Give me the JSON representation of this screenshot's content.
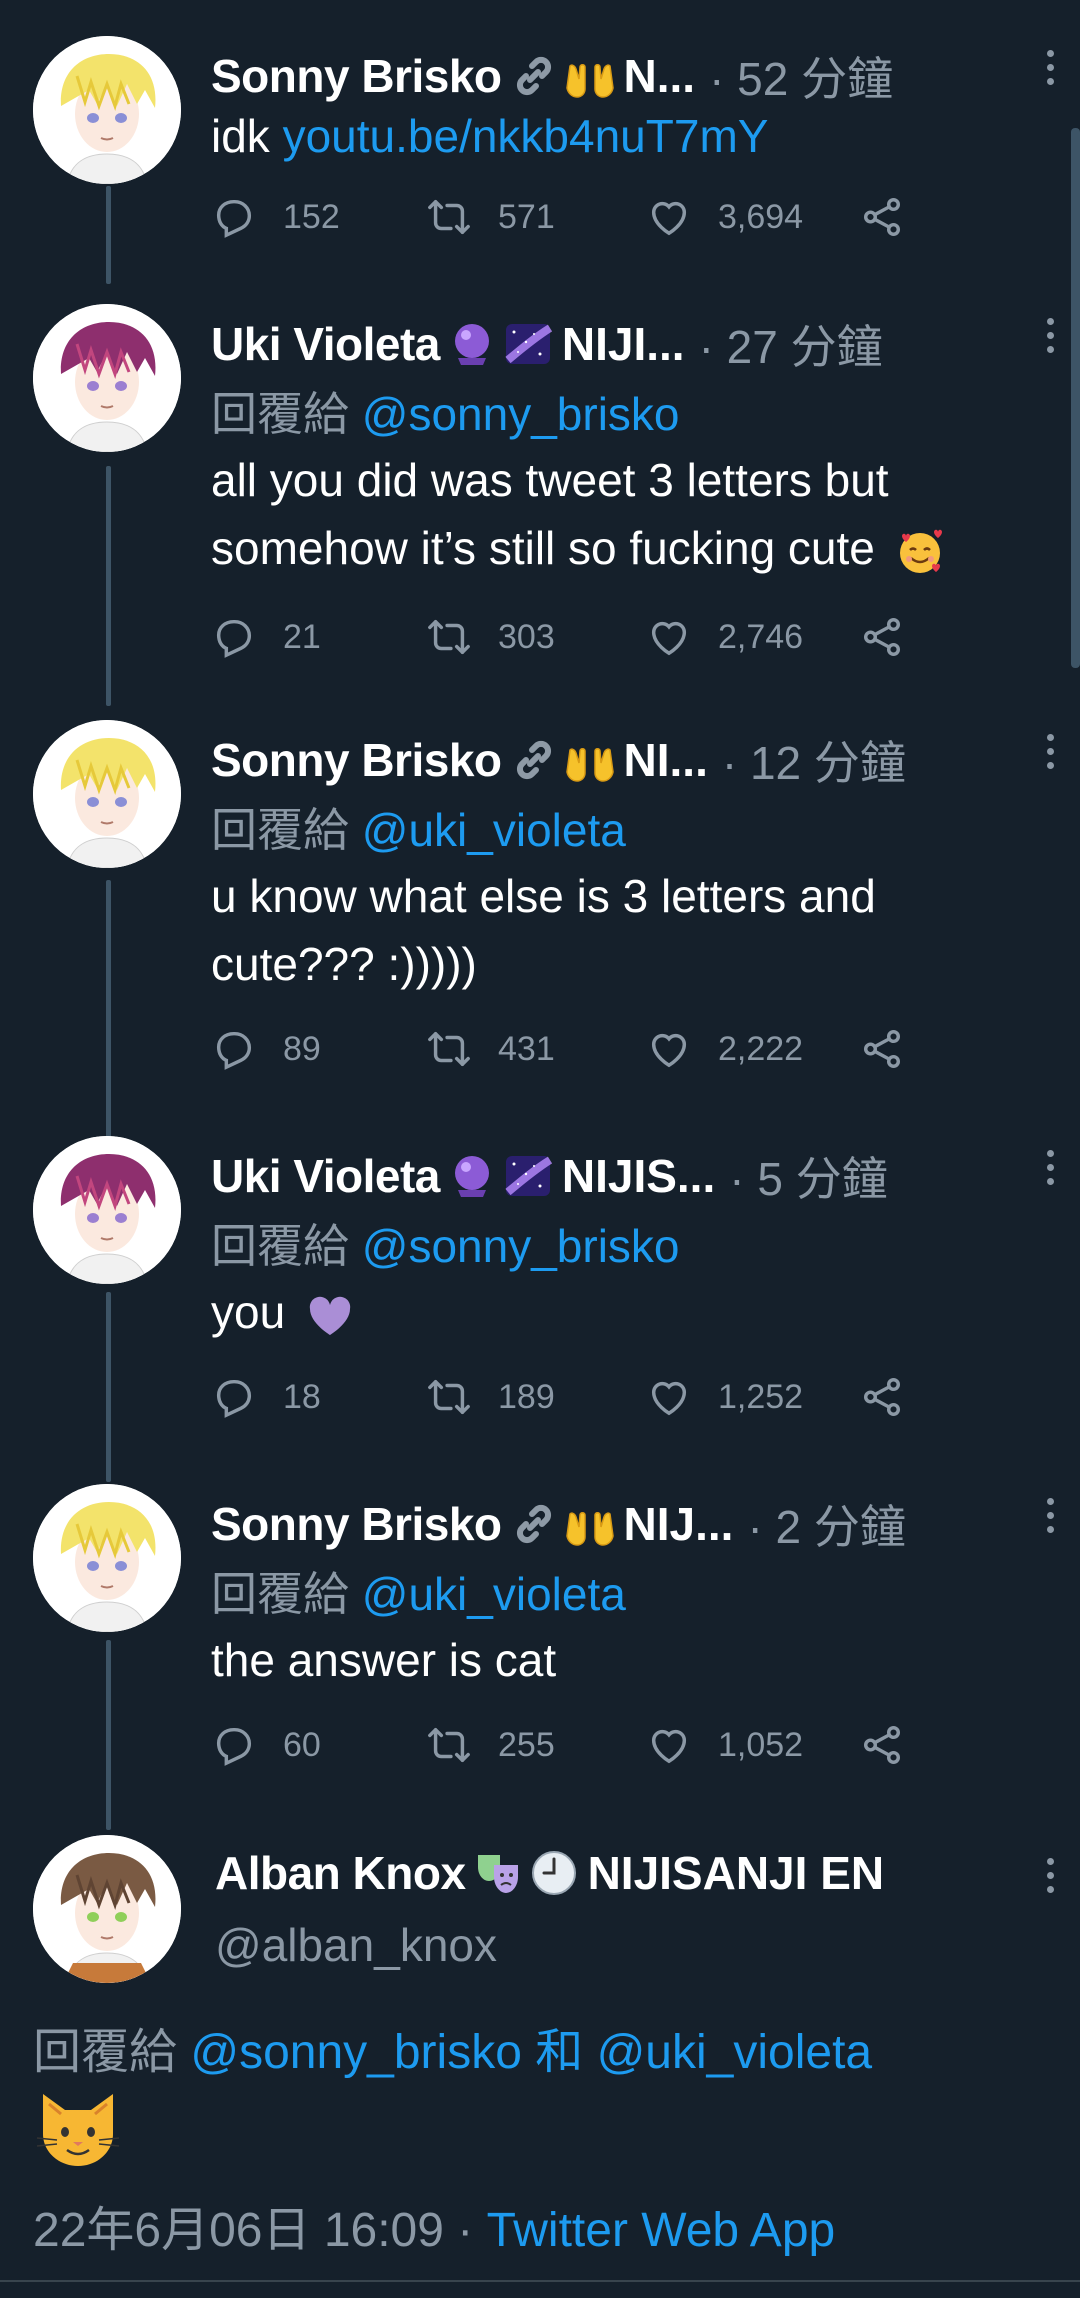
{
  "colors": {
    "background": "#15202b",
    "muted": "#8b98a5",
    "accent": "#1d9bf0",
    "thread_line": "#3d5466"
  },
  "thread": [
    {
      "name": "Sonny Brisko",
      "emojis": [
        "link-emoji",
        "open-hands-emoji"
      ],
      "org": "N...",
      "time": "· 52 分鐘",
      "reply_prefix": "",
      "reply_handle": "",
      "text": "idk ",
      "link": "youtu.be/nkkb4nuT7mY",
      "text2": "",
      "replies": "152",
      "retweets": "571",
      "likes": "3,694",
      "avatar": "sonny"
    },
    {
      "name": "Uki Violeta",
      "emojis": [
        "crystal-ball-emoji",
        "milky-way-emoji"
      ],
      "org": "NIJI...",
      "time": "· 27 分鐘",
      "reply_prefix": "回覆給 ",
      "reply_handle": "@sonny_brisko",
      "text": "all you did was tweet 3 letters but somehow it’s still so fucking cute ",
      "link": "",
      "text2": "",
      "replies": "21",
      "retweets": "303",
      "likes": "2,746",
      "avatar": "uki"
    },
    {
      "name": "Sonny Brisko",
      "emojis": [
        "link-emoji",
        "open-hands-emoji"
      ],
      "org": "NI...",
      "time": "· 12 分鐘",
      "reply_prefix": "回覆給 ",
      "reply_handle": "@uki_violeta",
      "text": "u know what else is 3 letters and cute??? :)))))",
      "link": "",
      "text2": "",
      "replies": "89",
      "retweets": "431",
      "likes": "2,222",
      "avatar": "sonny"
    },
    {
      "name": "Uki Violeta",
      "emojis": [
        "crystal-ball-emoji",
        "milky-way-emoji"
      ],
      "org": "NIJIS...",
      "time": "· 5 分鐘",
      "reply_prefix": "回覆給 ",
      "reply_handle": "@sonny_brisko",
      "text": "you ",
      "link": "",
      "text2": "",
      "replies": "18",
      "retweets": "189",
      "likes": "1,252",
      "avatar": "uki"
    },
    {
      "name": "Sonny Brisko",
      "emojis": [
        "link-emoji",
        "open-hands-emoji"
      ],
      "org": "NIJ...",
      "time": "· 2 分鐘",
      "reply_prefix": "回覆給 ",
      "reply_handle": "@uki_violeta",
      "text": "the answer is cat",
      "link": "",
      "text2": "",
      "replies": "60",
      "retweets": "255",
      "likes": "1,052",
      "avatar": "sonny"
    }
  ],
  "main_tweet": {
    "name": "Alban Knox",
    "emojis": [
      "performing-arts-emoji",
      "clock-emoji"
    ],
    "org": "NIJISANJI EN",
    "handle": "@alban_knox",
    "reply_prefix": "回覆給 ",
    "reply_handle_1": "@sonny_brisko",
    "reply_joiner": " 和 ",
    "reply_handle_2": "@uki_violeta",
    "body_emoji": "cat-face-emoji",
    "timestamp": "22年6月06日 16:09",
    "separator": " · ",
    "client": "Twitter Web App"
  }
}
